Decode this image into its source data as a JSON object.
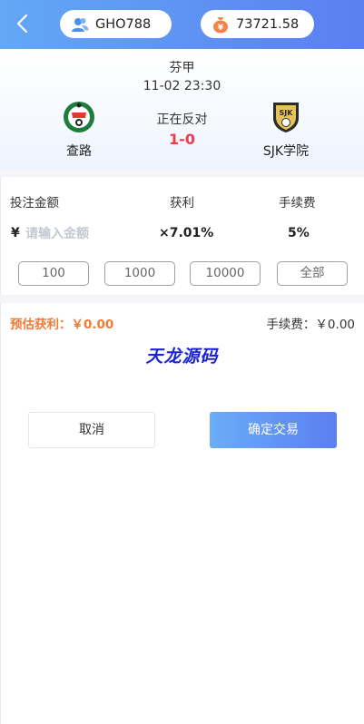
{
  "header": {
    "username": "GHO788",
    "balance": "73721.58",
    "icons": {
      "back": "chevron-left-icon",
      "user": "user-group-icon",
      "coin": "money-bag-icon"
    },
    "colors": {
      "gradient_start": "#62a8f6",
      "gradient_end": "#5b7ff0"
    }
  },
  "match": {
    "league": "芬甲",
    "time": "11-02 23:30",
    "status": "正在反对",
    "score": "1-0",
    "home": {
      "name": "查路",
      "logo": "jaro-club-crest-icon"
    },
    "away": {
      "name": "SJK学院",
      "logo": "sjk-shield-crest-icon"
    },
    "score_color": "#ef3b4a"
  },
  "bet_form": {
    "amount_label": "投注金额",
    "profit_label": "获利",
    "fee_label": "手续费",
    "currency_symbol": "¥",
    "amount_value": "",
    "amount_placeholder": "请输入金额",
    "odds": "×7.01%",
    "fee_rate": "5%",
    "quick_amounts": [
      "100",
      "1000",
      "10000",
      "全部"
    ]
  },
  "summary": {
    "estimated_profit": "预估获利：￥0.00",
    "fee_total": "手续费：￥0.00",
    "estimated_color": "#f27a35"
  },
  "watermark": "天龙源码",
  "actions": {
    "cancel": "取消",
    "confirm": "确定交易"
  }
}
